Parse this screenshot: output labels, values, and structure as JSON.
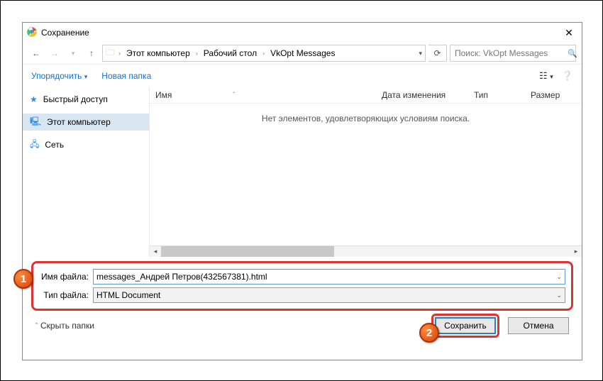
{
  "titlebar": {
    "title": "Сохранение"
  },
  "nav": {
    "breadcrumbs": [
      "Этот компьютер",
      "Рабочий стол",
      "VkOpt Messages"
    ],
    "search_placeholder": "Поиск: VkOpt Messages"
  },
  "toolbar": {
    "organize": "Упорядочить",
    "new_folder": "Новая папка"
  },
  "sidebar": {
    "items": [
      {
        "label": "Быстрый доступ",
        "icon": "star"
      },
      {
        "label": "Этот компьютер",
        "icon": "pc",
        "selected": true
      },
      {
        "label": "Сеть",
        "icon": "net"
      }
    ]
  },
  "columns": {
    "name": "Имя",
    "date": "Дата изменения",
    "type": "Тип",
    "size": "Размер"
  },
  "content": {
    "empty_msg": "Нет элементов, удовлетворяющих условиям поиска."
  },
  "fields": {
    "filename_label": "Имя файла:",
    "filename_value": "messages_Андрей Петров(432567381).html",
    "filetype_label": "Тип файла:",
    "filetype_value": "HTML Document"
  },
  "bottom": {
    "hide_folders": "Скрыть папки",
    "save": "Сохранить",
    "cancel": "Отмена"
  },
  "badges": {
    "one": "1",
    "two": "2"
  }
}
